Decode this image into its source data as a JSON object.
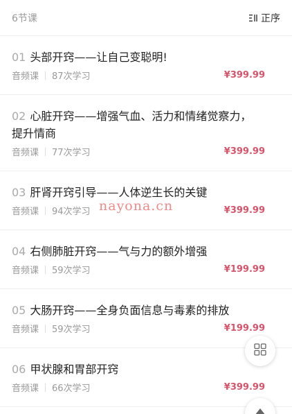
{
  "header": {
    "lesson_count": "6节课",
    "sort_label": "正序",
    "sort_icon": "sort-order-icon"
  },
  "lessons": [
    {
      "number": "01",
      "title_lines": [
        "头部开窍——让自己变聪明!"
      ],
      "type": "音频课",
      "views": "87次学习",
      "price": "¥399.99"
    },
    {
      "number": "02",
      "title_lines": [
        "心脏开窍——增强气血、活力和情绪觉察力，",
        "提升情商"
      ],
      "type": "音频课",
      "views": "77次学习",
      "price": "¥399.99"
    },
    {
      "number": "03",
      "title_lines": [
        "肝肾开窍引导——人体逆生长的关键"
      ],
      "type": "音频课",
      "views": "94次学习",
      "price": "¥399.99"
    },
    {
      "number": "04",
      "title_lines": [
        "右侧肺脏开窍——气与力的额外增强"
      ],
      "type": "音频课",
      "views": "59次学习",
      "price": "¥199.99"
    },
    {
      "number": "05",
      "title_lines": [
        "大肠开窍——全身负面信息与毒素的排放"
      ],
      "type": "音频课",
      "views": "59次学习",
      "price": "¥199.99"
    },
    {
      "number": "06",
      "title_lines": [
        "甲状腺和胃部开窍"
      ],
      "type": "音频课",
      "views": "66次学习",
      "price": "¥399.99"
    }
  ],
  "watermark": "nayona.cn",
  "floating_buttons": {
    "grid_icon": "grid-icon",
    "top_icon": "scroll-top-icon"
  },
  "colors": {
    "price": "#d8546a",
    "watermark": "#f08a8a",
    "divider": "#eeeeee"
  }
}
